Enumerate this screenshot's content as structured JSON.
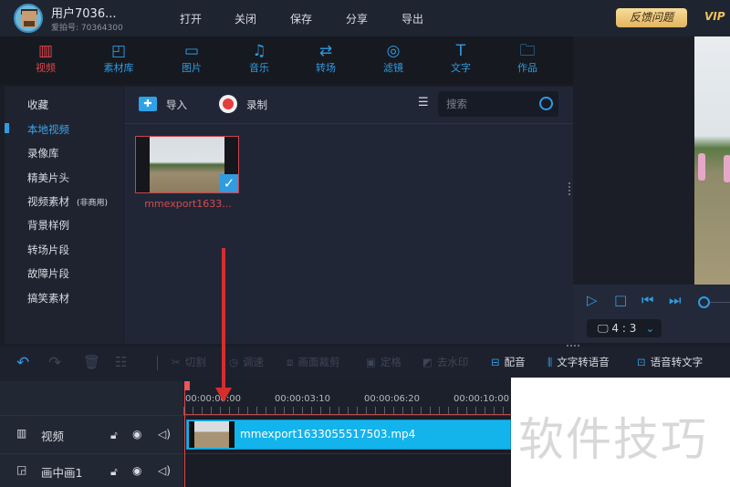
{
  "header": {
    "username": "用户7036...",
    "user_id": "爱拍号: 70364300",
    "menu": [
      "打开",
      "关闭",
      "保存",
      "分享",
      "导出"
    ],
    "feedback": "反馈问题",
    "vip": "VIP"
  },
  "categories": [
    {
      "label": "视频",
      "icon": "film-icon",
      "active": true
    },
    {
      "label": "素材库",
      "icon": "material-icon"
    },
    {
      "label": "图片",
      "icon": "image-icon"
    },
    {
      "label": "音乐",
      "icon": "music-icon"
    },
    {
      "label": "转场",
      "icon": "transition-icon"
    },
    {
      "label": "滤镜",
      "icon": "filter-icon"
    },
    {
      "label": "文字",
      "icon": "text-icon"
    },
    {
      "label": "作品",
      "icon": "folder-icon"
    }
  ],
  "sidebar": {
    "items": [
      "收藏",
      "本地视频",
      "录像库",
      "精美片头",
      "视频素材",
      "背景样例",
      "转场片段",
      "故障片段",
      "搞笑素材"
    ],
    "active": "本地视频",
    "note": "(非商用)"
  },
  "content": {
    "import": "导入",
    "record": "录制",
    "search_placeholder": "搜索",
    "file_name": "mmexport1633..."
  },
  "preview": {
    "ratio": "4 : 3"
  },
  "toolbar": {
    "cut": "切割",
    "speed": "调速",
    "crop": "画面裁剪",
    "freeze": "定格",
    "watermark": "去水印",
    "dub": "配音",
    "tts": "文字转语音",
    "stt": "语音转文字"
  },
  "timeline": {
    "ticks": [
      "00:00:00:00",
      "00:00:03:10",
      "00:00:06:20",
      "00:00:10:00"
    ],
    "tracks": [
      "视频",
      "画中画1"
    ],
    "clip_name": "mmexport1633055517503.mp4"
  },
  "watermark": "软件技巧",
  "colors": {
    "accent": "#2f9be0",
    "active_category": "#e0474c",
    "clip": "#13b3ec",
    "feedback_gold": "#f0c35a"
  }
}
